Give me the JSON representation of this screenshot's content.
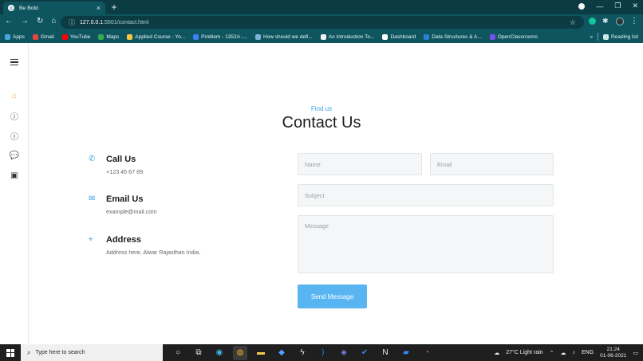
{
  "browser": {
    "tab_title": "Be Bold",
    "url_host": "127.0.0.1",
    "url_path": ":5501/contact.html",
    "bookmarks": [
      "Apps",
      "Gmail",
      "YouTube",
      "Maps",
      "Applied Course - Yo...",
      "Problem - 1352A -...",
      "How should we defi...",
      "An Introduction To...",
      "Dashboard",
      "Data Structures & A...",
      "OpenClassrooms"
    ],
    "more_label": "»",
    "reading_list": "Reading list"
  },
  "page": {
    "hero_subtitle": "Find us",
    "hero_title": "Contact Us",
    "contacts": [
      {
        "title": "Call Us",
        "detail": "+123 45 67 89"
      },
      {
        "title": "Email Us",
        "detail": "example@mail.com"
      },
      {
        "title": "Address",
        "detail": "Address here, Alwar Rajasthan India."
      }
    ],
    "form": {
      "name_placeholder": "Name",
      "email_placeholder": "Email",
      "subject_placeholder": "Subject",
      "message_placeholder": "Message",
      "send_label": "Send Message"
    }
  },
  "taskbar": {
    "search_placeholder": "Type here to search",
    "weather": "27°C  Light rain",
    "lang": "ENG",
    "time": "21:24",
    "date": "01-06-2021"
  },
  "colors": {
    "chrome_dark": "#0b3c44",
    "chrome": "#0f5560",
    "accent_blue": "#3da2e8",
    "button_blue": "#58b5f2"
  }
}
